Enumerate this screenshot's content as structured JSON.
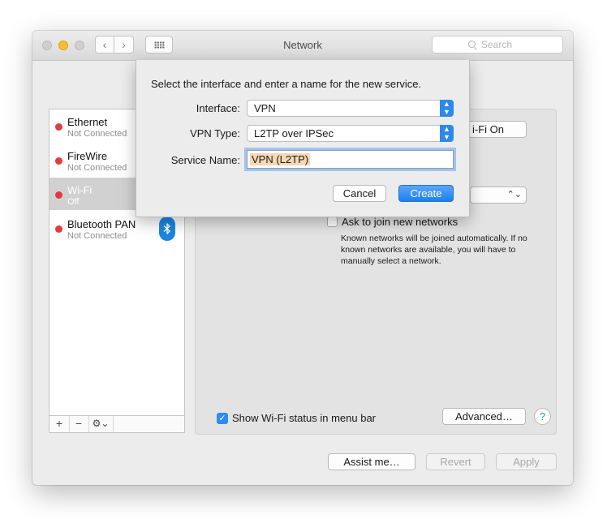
{
  "window": {
    "title": "Network",
    "search_placeholder": "Search",
    "nav": {
      "back": "‹",
      "forward": "›"
    }
  },
  "sidebar": {
    "services": [
      {
        "name": "Ethernet",
        "status": "Not Connected",
        "status_color": "#e5393f"
      },
      {
        "name": "FireWire",
        "status": "Not Connected",
        "status_color": "#e5393f"
      },
      {
        "name": "Wi-Fi",
        "status": "Off",
        "status_color": "#e5393f",
        "selected": true
      },
      {
        "name": "Bluetooth PAN",
        "status": "Not Connected",
        "status_color": "#e5393f",
        "icon": "bluetooth-icon"
      }
    ],
    "toolbar": {
      "add": "+",
      "remove": "−",
      "gear": "⚙⌄"
    }
  },
  "panel": {
    "wifi_on_label": "i-Fi On",
    "ask_label": "Ask to join new networks",
    "ask_description": "Known networks will be joined automatically. If no known networks are available, you will have to manually select a network.",
    "show_status_label": "Show Wi-Fi status in menu bar",
    "show_status_checked": true,
    "advanced_label": "Advanced…",
    "help_label": "?"
  },
  "footer": {
    "assist": "Assist me…",
    "revert": "Revert",
    "apply": "Apply"
  },
  "sheet": {
    "title": "Select the interface and enter a name for the new service.",
    "interface_label": "Interface:",
    "interface_value": "VPN",
    "vpn_type_label": "VPN Type:",
    "vpn_type_value": "L2TP over IPSec",
    "service_name_label": "Service Name:",
    "service_name_value": "VPN (L2TP)",
    "cancel": "Cancel",
    "create": "Create"
  }
}
